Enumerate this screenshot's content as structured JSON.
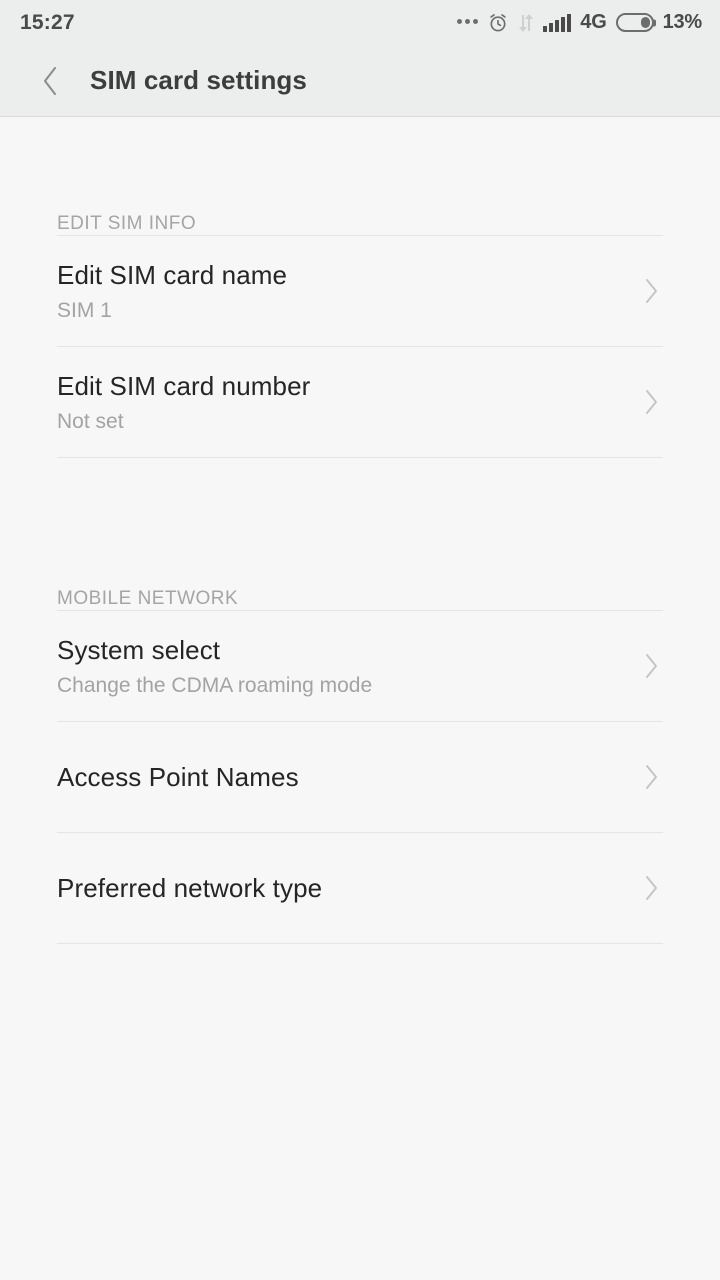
{
  "status_bar": {
    "time": "15:27",
    "network_type": "4G",
    "battery_percent": "13%",
    "icons": [
      "more-ellipsis-icon",
      "alarm-clock-icon",
      "data-transfer-icon",
      "signal-bars-icon",
      "battery-icon"
    ]
  },
  "header": {
    "back_icon": "chevron-left-icon",
    "title": "SIM card settings"
  },
  "sections": [
    {
      "label": "EDIT SIM INFO",
      "rows": [
        {
          "title": "Edit SIM card name",
          "subtitle": "SIM 1"
        },
        {
          "title": "Edit SIM card number",
          "subtitle": "Not set"
        }
      ]
    },
    {
      "label": "MOBILE NETWORK",
      "rows": [
        {
          "title": "System select",
          "subtitle": "Change the CDMA roaming mode"
        },
        {
          "title": "Access Point Names",
          "subtitle": ""
        },
        {
          "title": "Preferred network type",
          "subtitle": ""
        }
      ]
    }
  ],
  "colors": {
    "page_background": "#f7f7f7",
    "bar_background": "#eceeed",
    "title_text": "#252525",
    "subtitle_text": "#a3a3a3",
    "section_label": "#a5a5a5",
    "divider": "#e4e4e4",
    "chevron": "#c4c4c4"
  }
}
